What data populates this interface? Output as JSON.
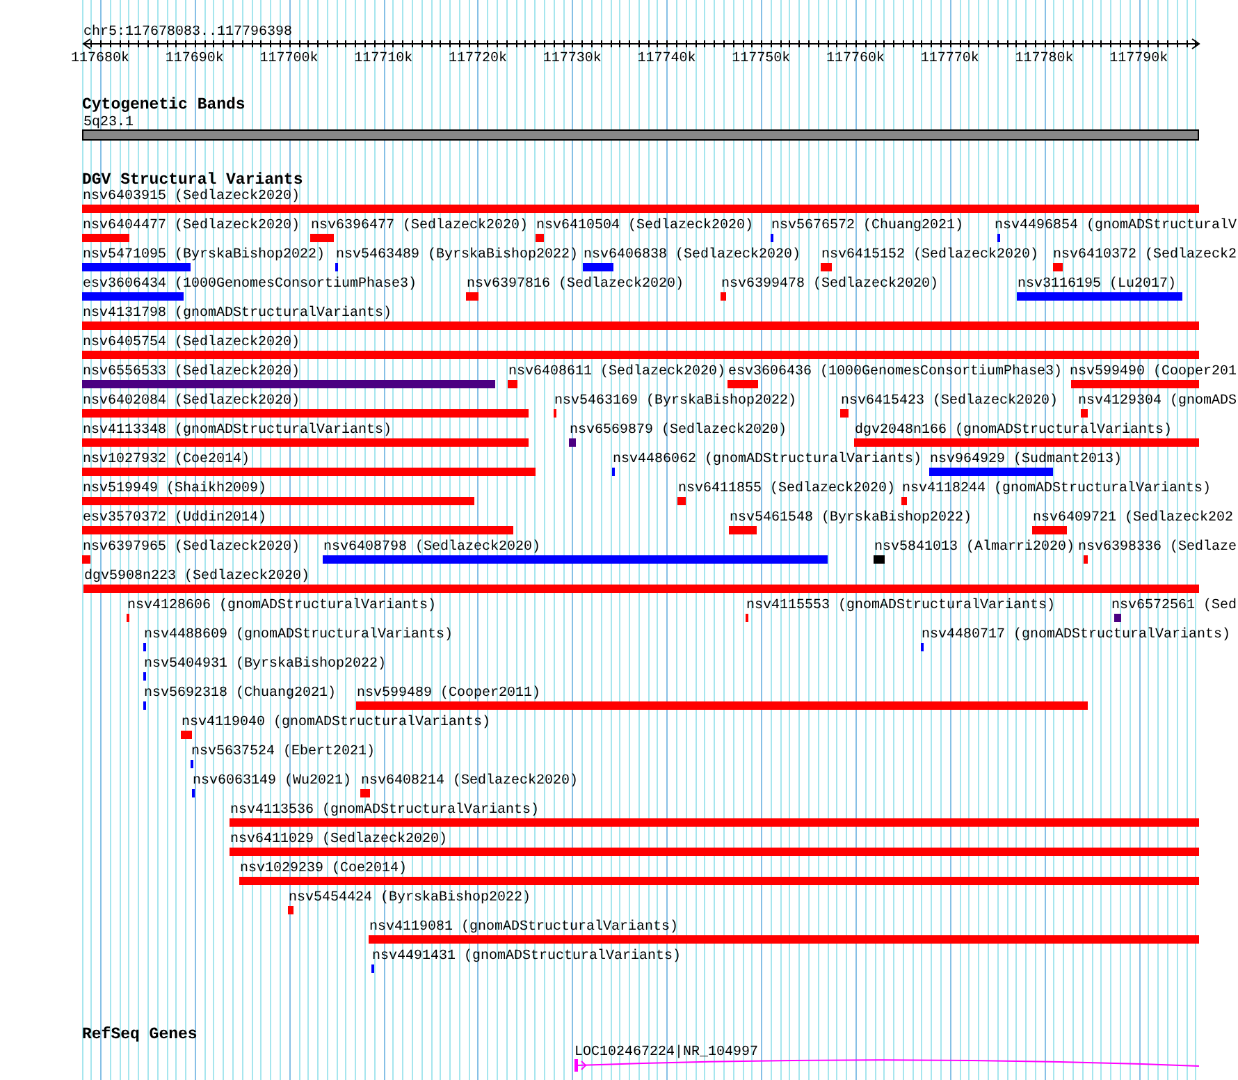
{
  "ruler": {
    "position": "chr5:117678083..117796398",
    "tick_labels": [
      "117680k",
      "117690k",
      "117700k",
      "117710k",
      "117720k",
      "117730k",
      "117740k",
      "117750k",
      "117760k",
      "117770k",
      "117780k",
      "117790k"
    ]
  },
  "tracks": [
    {
      "kind": "bands",
      "title": "Cytogenetic Bands",
      "items": [
        {
          "label": "5q23.1",
          "color": "#888888"
        }
      ]
    },
    {
      "kind": "variants",
      "title": "DGV Structural Variants",
      "rows": [
        [
          {
            "label": "nsv6403915 (Sedlazeck2020)",
            "color": "#ff0000"
          }
        ],
        [
          {
            "label": "nsv6404477 (Sedlazeck2020)",
            "color": "#ff0000"
          },
          {
            "label": "nsv6396477 (Sedlazeck2020)",
            "color": "#ff0000"
          },
          {
            "label": "nsv6410504 (Sedlazeck2020)",
            "color": "#ff0000"
          },
          {
            "label": "nsv5676572 (Chuang2021)",
            "color": "#0000ff"
          },
          {
            "label": "nsv4496854 (gnomADStructuralV",
            "color": "#0000ff"
          }
        ],
        [
          {
            "label": "nsv5471095 (ByrskaBishop2022)",
            "color": "#0000ff"
          },
          {
            "label": "nsv5463489 (ByrskaBishop2022)",
            "color": "#0000ff"
          },
          {
            "label": "nsv6406838 (Sedlazeck2020)",
            "color": "#0000ff"
          },
          {
            "label": "nsv6415152 (Sedlazeck2020)",
            "color": "#ff0000"
          },
          {
            "label": "nsv6410372 (Sedlazeck2",
            "color": "#ff0000"
          }
        ],
        [
          {
            "label": "esv3606434 (1000GenomesConsortiumPhase3)",
            "color": "#0000ff"
          },
          {
            "label": "nsv6397816 (Sedlazeck2020)",
            "color": "#ff0000"
          },
          {
            "label": "nsv6399478 (Sedlazeck2020)",
            "color": "#ff0000"
          },
          {
            "label": "nsv3116195 (Lu2017)",
            "color": "#0000ff"
          }
        ],
        [
          {
            "label": "nsv4131798 (gnomADStructuralVariants)",
            "color": "#ff0000"
          }
        ],
        [
          {
            "label": "nsv6405754 (Sedlazeck2020)",
            "color": "#ff0000"
          }
        ],
        [
          {
            "label": "nsv6556533 (Sedlazeck2020)",
            "color": "#4b0082"
          },
          {
            "label": "nsv6408611 (Sedlazeck2020)",
            "color": "#ff0000"
          },
          {
            "label": "esv3606436 (1000GenomesConsortiumPhase3)",
            "color": "#ff0000"
          },
          {
            "label": "nsv599490 (Cooper201",
            "color": "#ff0000"
          }
        ],
        [
          {
            "label": "nsv6402084 (Sedlazeck2020)",
            "color": "#ff0000"
          },
          {
            "label": "nsv5463169 (ByrskaBishop2022)",
            "color": "#ff0000"
          },
          {
            "label": "nsv6415423 (Sedlazeck2020)",
            "color": "#ff0000"
          },
          {
            "label": "nsv4129304 (gnomADS",
            "color": "#ff0000"
          }
        ],
        [
          {
            "label": "nsv4113348 (gnomADStructuralVariants)",
            "color": "#ff0000"
          },
          {
            "label": "nsv6569879 (Sedlazeck2020)",
            "color": "#4b0082"
          },
          {
            "label": "dgv2048n166 (gnomADStructuralVariants)",
            "color": "#ff0000"
          }
        ],
        [
          {
            "label": "nsv1027932 (Coe2014)",
            "color": "#ff0000"
          },
          {
            "label": "nsv4486062 (gnomADStructuralVariants)",
            "color": "#0000ff"
          },
          {
            "label": "nsv964929 (Sudmant2013)",
            "color": "#0000ff"
          }
        ],
        [
          {
            "label": "nsv519949 (Shaikh2009)",
            "color": "#ff0000"
          },
          {
            "label": "nsv6411855 (Sedlazeck2020)",
            "color": "#ff0000"
          },
          {
            "label": "nsv4118244 (gnomADStructuralVariants)",
            "color": "#ff0000"
          }
        ],
        [
          {
            "label": "esv3570372 (Uddin2014)",
            "color": "#ff0000"
          },
          {
            "label": "nsv5461548 (ByrskaBishop2022)",
            "color": "#ff0000"
          },
          {
            "label": "nsv6409721 (Sedlazeck202",
            "color": "#ff0000"
          }
        ],
        [
          {
            "label": "nsv6397965 (Sedlazeck2020)",
            "color": "#ff0000"
          },
          {
            "label": "nsv6408798 (Sedlazeck2020)",
            "color": "#0000ff"
          },
          {
            "label": "nsv5841013 (Almarri2020)",
            "color": "#000000"
          },
          {
            "label": "nsv6398336 (Sedlaze",
            "color": "#ff0000"
          }
        ],
        [
          {
            "label": "dgv5908n223 (Sedlazeck2020)",
            "color": "#ff0000"
          }
        ],
        [
          {
            "label": "nsv4128606 (gnomADStructuralVariants)",
            "color": "#ff0000"
          },
          {
            "label": "nsv4115553 (gnomADStructuralVariants)",
            "color": "#ff0000"
          },
          {
            "label": "nsv6572561 (Sed",
            "color": "#4b0082"
          }
        ],
        [
          {
            "label": "nsv4488609 (gnomADStructuralVariants)",
            "color": "#0000ff"
          },
          {
            "label": "nsv4480717 (gnomADStructuralVariants)",
            "color": "#0000ff"
          }
        ],
        [
          {
            "label": "nsv5404931 (ByrskaBishop2022)",
            "color": "#0000ff"
          }
        ],
        [
          {
            "label": "nsv5692318 (Chuang2021)",
            "color": "#0000ff"
          },
          {
            "label": "nsv599489 (Cooper2011)",
            "color": "#ff0000"
          }
        ],
        [
          {
            "label": "nsv4119040 (gnomADStructuralVariants)",
            "color": "#ff0000"
          }
        ],
        [
          {
            "label": "nsv5637524 (Ebert2021)",
            "color": "#0000ff"
          }
        ],
        [
          {
            "label": "nsv6063149 (Wu2021)",
            "color": "#0000ff"
          },
          {
            "label": "nsv6408214 (Sedlazeck2020)",
            "color": "#ff0000"
          }
        ],
        [
          {
            "label": "nsv4113536 (gnomADStructuralVariants)",
            "color": "#ff0000"
          }
        ],
        [
          {
            "label": "nsv6411029 (Sedlazeck2020)",
            "color": "#ff0000"
          }
        ],
        [
          {
            "label": "nsv1029239 (Coe2014)",
            "color": "#ff0000"
          }
        ],
        [
          {
            "label": "nsv5454424 (ByrskaBishop2022)",
            "color": "#ff0000"
          }
        ],
        [
          {
            "label": "nsv4119081 (gnomADStructuralVariants)",
            "color": "#ff0000"
          }
        ],
        [
          {
            "label": "nsv4491431 (gnomADStructuralVariants)",
            "color": "#0000ff"
          }
        ]
      ]
    },
    {
      "kind": "genes",
      "title": "RefSeq Genes",
      "items": [
        {
          "label": "LOC102467224|NR_104997",
          "color": "#ff00ff"
        }
      ]
    }
  ]
}
